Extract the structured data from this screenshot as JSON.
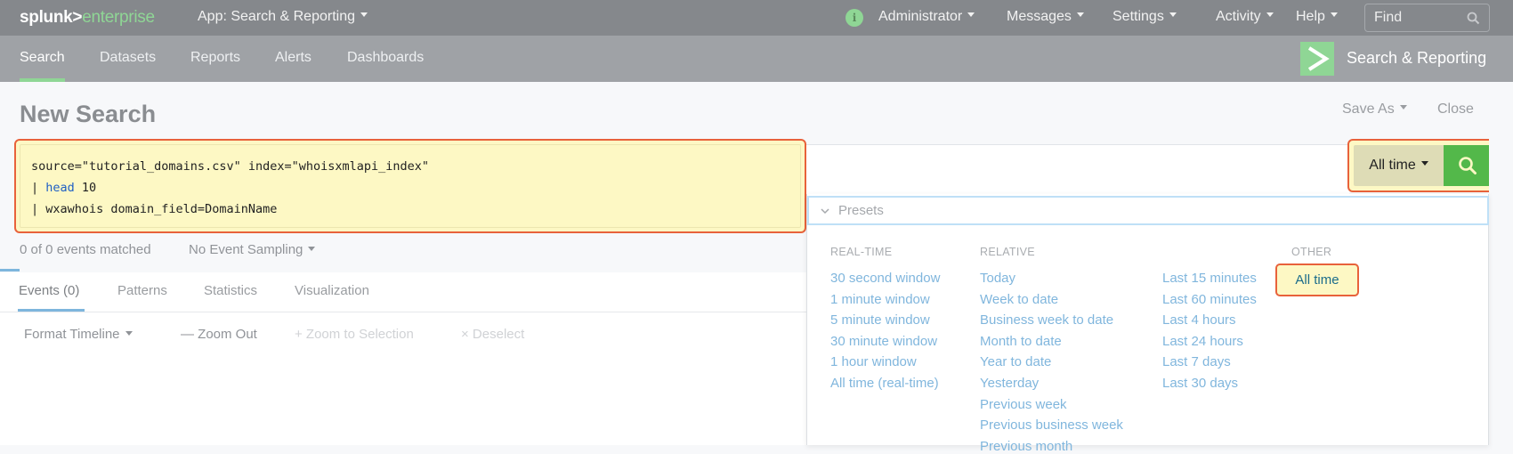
{
  "topbar": {
    "logo_bold": "splunk>",
    "logo_light": "enterprise",
    "app_menu": "App: Search & Reporting",
    "menus": [
      "Administrator",
      "Messages",
      "Settings",
      "Activity",
      "Help"
    ],
    "info_icon_glyph": "i",
    "find_placeholder": "Find"
  },
  "nav": {
    "items": [
      "Search",
      "Datasets",
      "Reports",
      "Alerts",
      "Dashboards"
    ],
    "active": "Search",
    "app_title": "Search & Reporting",
    "accent_color": "#8fd695"
  },
  "page": {
    "title": "New Search",
    "save_as": "Save As",
    "close": "Close"
  },
  "search": {
    "line1": "source=\"tutorial_domains.csv\" index=\"whoisxmlapi_index\"",
    "line2_pipe": "| ",
    "line2_kw": "head",
    "line2_rest": " 10",
    "line3": "| wxawhois domain_field=DomainName"
  },
  "timepicker": {
    "value": "All time",
    "go_color": "#53b84a"
  },
  "status": {
    "matched": "0 of 0 events matched",
    "sampling": "No Event Sampling"
  },
  "tabs": [
    "Events (0)",
    "Patterns",
    "Statistics",
    "Visualization"
  ],
  "timeline": {
    "format": "Format Timeline",
    "zoom_out": "— Zoom Out",
    "zoom_sel": "+ Zoom to Selection",
    "deselect": "× Deselect"
  },
  "presets": {
    "header": "Presets",
    "realtime_title": "REAL-TIME",
    "realtime": [
      "30 second window",
      "1 minute window",
      "5 minute window",
      "30 minute window",
      "1 hour window",
      "All time (real-time)"
    ],
    "relative_title": "RELATIVE",
    "relative_a": [
      "Today",
      "Week to date",
      "Business week to date",
      "Month to date",
      "Year to date",
      "Yesterday",
      "Previous week",
      "Previous business week",
      "Previous month"
    ],
    "relative_b": [
      "Last 15 minutes",
      "Last 60 minutes",
      "Last 4 hours",
      "Last 24 hours",
      "Last 7 days",
      "Last 30 days"
    ],
    "other_title": "OTHER",
    "other": [
      "All time"
    ],
    "selected": "All time"
  }
}
